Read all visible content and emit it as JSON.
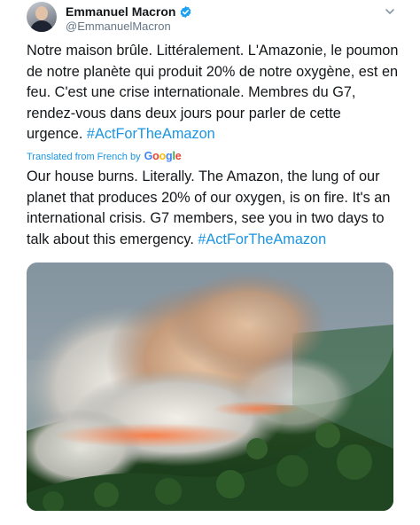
{
  "author": {
    "display_name": "Emmanuel Macron",
    "handle": "@EmmanuelMacron",
    "verified_icon": "verified-badge-icon"
  },
  "menu_icon": "chevron-down-icon",
  "tweet": {
    "original_text": "Notre maison brûle. Littéralement. L'Amazonie, le poumon de notre planète qui produit 20% de notre oxygène, est en feu. C'est une crise internationale. Membres du G7, rendez-vous dans deux jours pour parler de cette urgence.",
    "original_hashtag": "#ActForTheAmazon",
    "translation_label": "Translated from French by",
    "translation_provider": "Google",
    "translated_text": "Our house burns. Literally. The Amazon, the lung of our planet that produces 20% of our oxygen, is on fire. It's an international crisis. G7 members, see you in two days to talk about this emergency.",
    "translated_hashtag": "#ActForTheAmazon"
  },
  "media": {
    "description_icon": "forest-fire-photo"
  },
  "colors": {
    "link": "#1b95e0",
    "verified": "#1da1f2",
    "secondary_text": "#657786"
  }
}
